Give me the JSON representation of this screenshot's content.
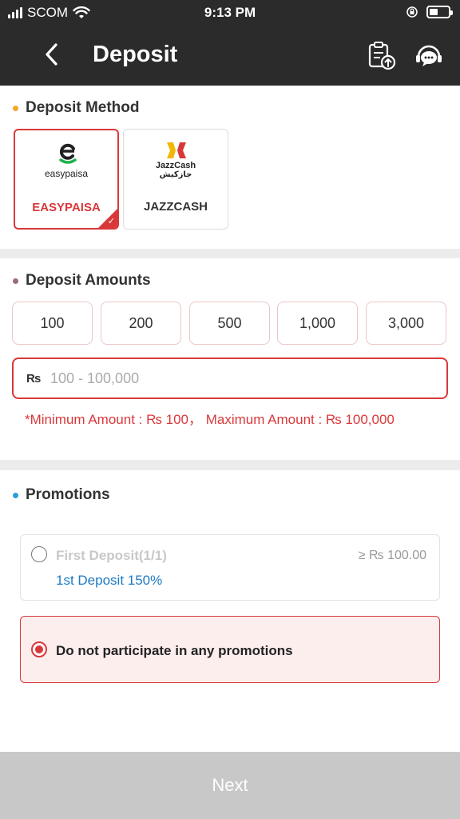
{
  "status_bar": {
    "carrier": "SCOM",
    "time": "9:13 PM",
    "battery_level": 0.45
  },
  "header": {
    "title": "Deposit",
    "icons": [
      "back-icon",
      "clipboard-upload-icon",
      "customer-support-icon"
    ]
  },
  "deposit_method": {
    "title": "Deposit Method",
    "dot_color": "#f5a623",
    "methods": [
      {
        "logo_text": "easypaisa",
        "label": "EASYPAISA",
        "selected": true
      },
      {
        "logo_text": "JazzCash",
        "logo_text_urdu": "جازکیش",
        "label": "JAZZCASH",
        "selected": false
      }
    ]
  },
  "deposit_amounts": {
    "title": "Deposit Amounts",
    "dot_color": "#9b6b7c",
    "presets": [
      "100",
      "200",
      "500",
      "1,000",
      "3,000"
    ],
    "currency_symbol": "₨",
    "input_placeholder": "100 - 100,000",
    "input_value": "",
    "limit_note": "*Minimum Amount : ₨ 100， Maximum Amount : ₨ 100,000"
  },
  "promotions": {
    "title": "Promotions",
    "dot_color": "#2a9fd8",
    "items": [
      {
        "name": "First Deposit(1/1)",
        "minimum": "≥ ₨ 100.00",
        "description": "1st Deposit 150%",
        "selected": false
      },
      {
        "name": "Do not participate in any promotions",
        "selected": true
      }
    ]
  },
  "next_button": {
    "label": "Next",
    "enabled": false
  },
  "colors": {
    "header_bg": "#2b2b2b",
    "accent_red": "#d9383a",
    "promo_blue": "#1e7ac4",
    "disabled_gray": "#c8c8c8"
  }
}
